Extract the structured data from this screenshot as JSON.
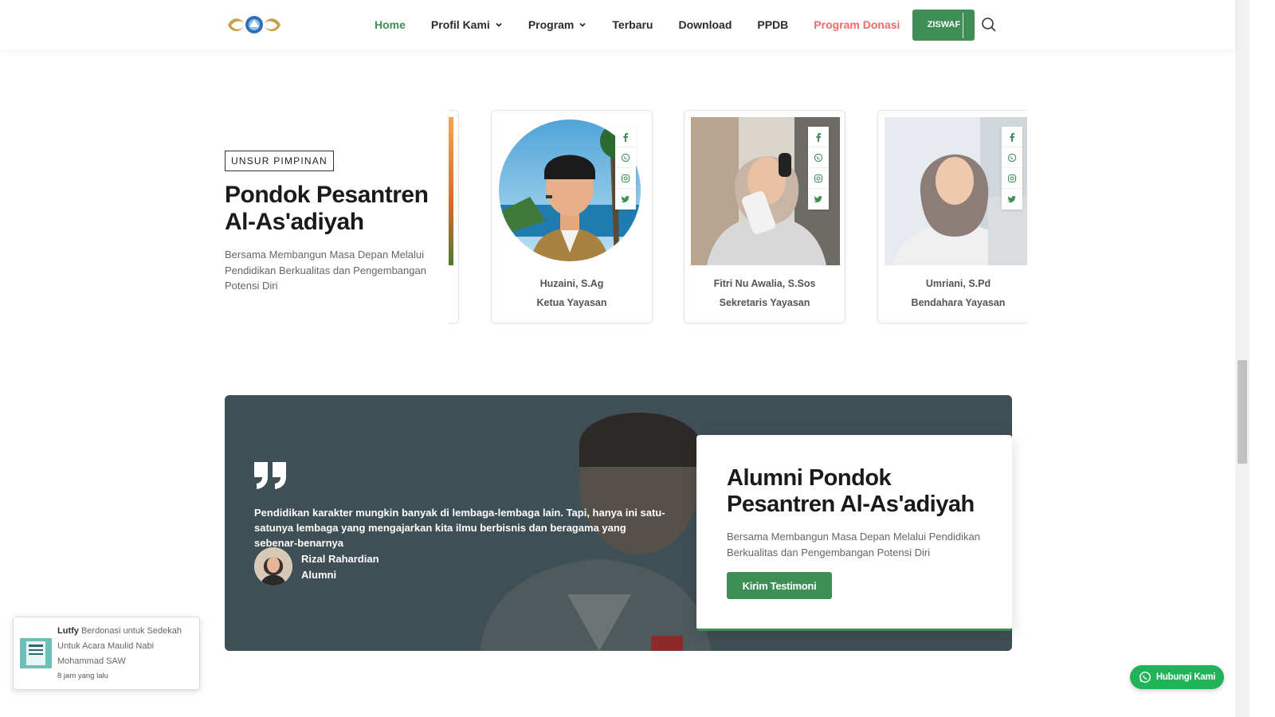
{
  "nav": {
    "items": [
      {
        "label": "Home",
        "dropdown": false,
        "state": "active"
      },
      {
        "label": "Profil Kami",
        "dropdown": true
      },
      {
        "label": "Program",
        "dropdown": true
      },
      {
        "label": "Terbaru",
        "dropdown": false
      },
      {
        "label": "Download",
        "dropdown": false
      },
      {
        "label": "PPDB",
        "dropdown": false
      },
      {
        "label": "Program Donasi",
        "dropdown": false,
        "state": "highlight"
      }
    ],
    "cta_label": "ZISWAF"
  },
  "leadership": {
    "badge": "UNSUR PIMPINAN",
    "title": "Pondok Pesantren Al-As'adiyah",
    "description": "Bersama Membangun Masa Depan Melalui Pendidikan Berkualitas dan Pengembangan Potensi Diri",
    "members": [
      {
        "name": "Huzaini, S.Ag",
        "role": "Ketua Yayasan"
      },
      {
        "name": "Fitri Nu Awalia, S.Sos",
        "role": "Sekretaris Yayasan"
      },
      {
        "name": "Umriani, S.Pd",
        "role": "Bendahara Yayasan"
      }
    ],
    "social_icons": [
      "facebook-icon",
      "whatsapp-icon",
      "instagram-icon",
      "twitter-icon"
    ]
  },
  "testimonial": {
    "quote": "Pendidikan karakter mungkin banyak di lembaga-lembaga lain. Tapi, hanya ini satu-satunya lembaga yang mengajarkan kita ilmu berbisnis dan beragama yang sebenar-benarnya",
    "author_name": "Rizal Rahardian",
    "author_role": "Alumni"
  },
  "alumni": {
    "title": "Alumni Pondok Pesantren Al-As'adiyah",
    "description": "Bersama Membangun Masa Depan Melalui Pendidikan Berkualitas dan Pengembangan Potensi Diri",
    "button_label": "Kirim Testimoni"
  },
  "notification": {
    "donor": "Lutfy",
    "action": "Berdonasi untuk",
    "campaign": "Sedekah Untuk Acara Maulid Nabi Mohammad SAW",
    "time": "8 jam yang lalu"
  },
  "whatsapp": {
    "label": "Hubungi Kami"
  },
  "colors": {
    "primary": "#3e8e55",
    "donasi": "#ef6a6a",
    "whatsapp": "#22b35a",
    "testimonial_bg": "#3f4f56"
  }
}
